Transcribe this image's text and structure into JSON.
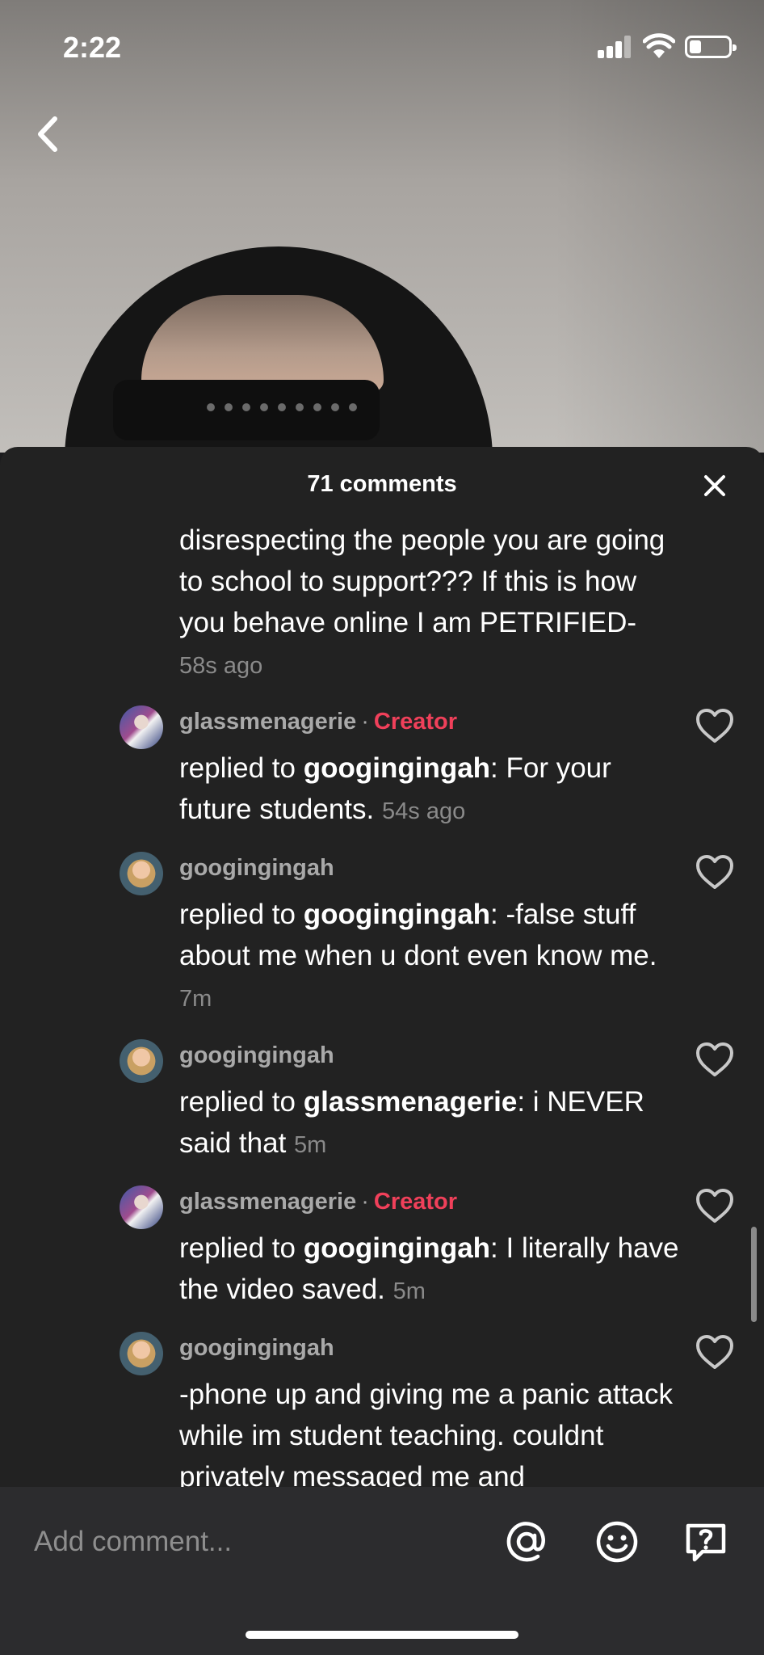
{
  "status_bar": {
    "time": "2:22"
  },
  "comments_header": {
    "title": "71 comments"
  },
  "truncated_comment": {
    "text": "disrespecting the people you are going to school to support??? If this is how you behave online I am PETRIFIED-",
    "time": "58s ago"
  },
  "comments": [
    {
      "username": "glassmenagerie",
      "badge": "Creator",
      "prefix": "replied to ",
      "reply_to": "googingingah",
      "text": ": For your future students.",
      "time": "54s ago"
    },
    {
      "username": "googingingah",
      "badge": "",
      "prefix": "replied to ",
      "reply_to": "googingingah",
      "text": ": -false stuff about me when u dont even know me.",
      "time": "7m"
    },
    {
      "username": "googingingah",
      "badge": "",
      "prefix": "replied to ",
      "reply_to": "glassmenagerie",
      "text": ": i NEVER said that",
      "time": "5m"
    },
    {
      "username": "glassmenagerie",
      "badge": "Creator",
      "prefix": "replied to ",
      "reply_to": "googingingah",
      "text": ": I literally have the video saved.",
      "time": "5m"
    },
    {
      "username": "googingingah",
      "badge": "",
      "prefix": "",
      "reply_to": "",
      "text": "-phone up and giving me a panic attack while im student teaching. couldnt privately messaged me and",
      "time": ""
    }
  ],
  "input": {
    "placeholder": "Add comment..."
  },
  "colors": {
    "creator_badge": "#f0405a",
    "sheet_bg": "#222222",
    "input_bar_bg": "#2c2c2e"
  }
}
